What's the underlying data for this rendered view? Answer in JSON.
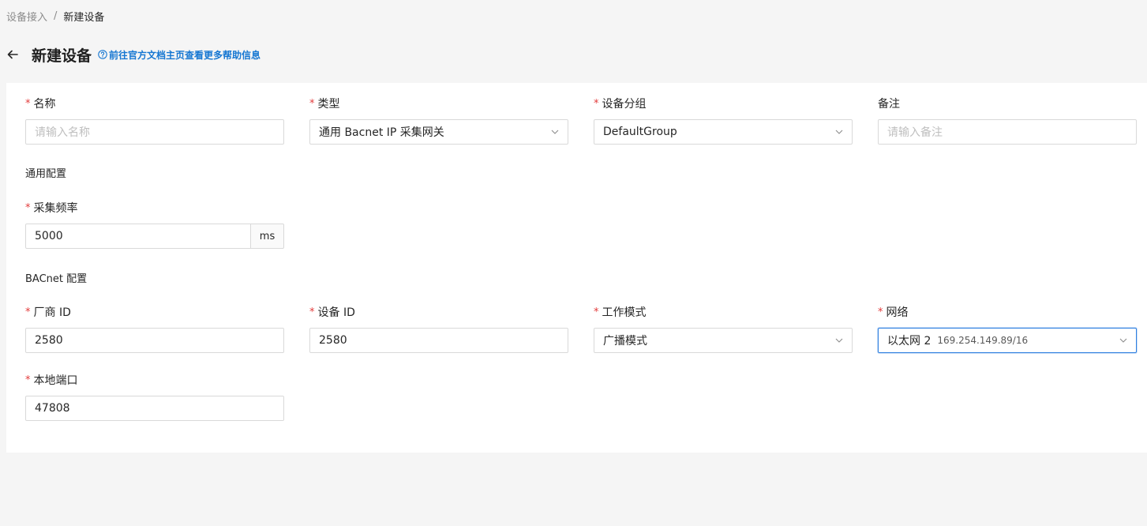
{
  "breadcrumb": {
    "parent": "设备接入",
    "separator": "/",
    "current": "新建设备"
  },
  "header": {
    "title": "新建设备",
    "help_link": "前往官方文档主页查看更多帮助信息"
  },
  "form": {
    "name": {
      "label": "名称",
      "placeholder": "请输入名称",
      "value": ""
    },
    "type": {
      "label": "类型",
      "value": "通用 Bacnet IP 采集网关"
    },
    "group": {
      "label": "设备分组",
      "value": "DefaultGroup"
    },
    "remark": {
      "label": "备注",
      "placeholder": "请输入备注",
      "value": ""
    },
    "general_section": "通用配置",
    "frequency": {
      "label": "采集频率",
      "value": "5000",
      "unit": "ms"
    },
    "bacnet_section": "BACnet 配置",
    "vendor_id": {
      "label": "厂商 ID",
      "value": "2580"
    },
    "device_id": {
      "label": "设备 ID",
      "value": "2580"
    },
    "work_mode": {
      "label": "工作模式",
      "value": "广播模式"
    },
    "network": {
      "label": "网络",
      "value": "以太网 2",
      "ip": "169.254.149.89/16"
    },
    "local_port": {
      "label": "本地端口",
      "value": "47808"
    },
    "required_mark": "*"
  },
  "colors": {
    "accent": "#1677d2",
    "required": "#e23b3b",
    "focus_border": "#2f7fe0"
  },
  "icons": {
    "back": "arrow-left-icon",
    "help": "question-circle-icon",
    "select": "chevron-down-icon"
  }
}
